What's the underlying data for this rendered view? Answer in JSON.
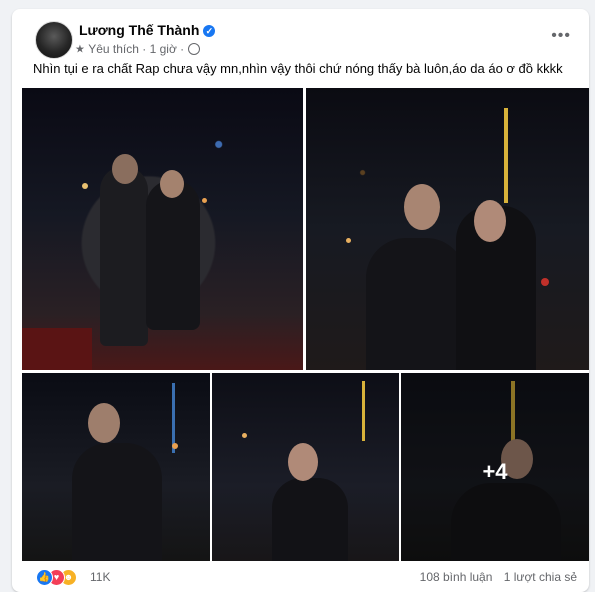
{
  "post": {
    "author": "Lương Thế Thành",
    "verified_icon": "check-badge-icon",
    "meta_audience": "Yêu thích",
    "meta_time": "1 giờ",
    "meta_separator": "·",
    "caption": "Nhìn tụi e ra chất Rap chưa vậy mn,nhìn vậy thôi chứ nóng thấy bà luôn,áo da áo ơ đồ kkkk",
    "more_photos_label": "+4",
    "more_menu": "•••"
  },
  "engagement": {
    "reaction_icons": [
      "like-icon",
      "love-icon",
      "haha-icon"
    ],
    "reaction_count": "11K",
    "comments": "108 bình luận",
    "shares": "1 lượt chia sẻ"
  },
  "colors": {
    "like": "#1877f2",
    "love": "#f33e58",
    "haha": "#f7b125",
    "accent_light": "#d8b23a"
  }
}
